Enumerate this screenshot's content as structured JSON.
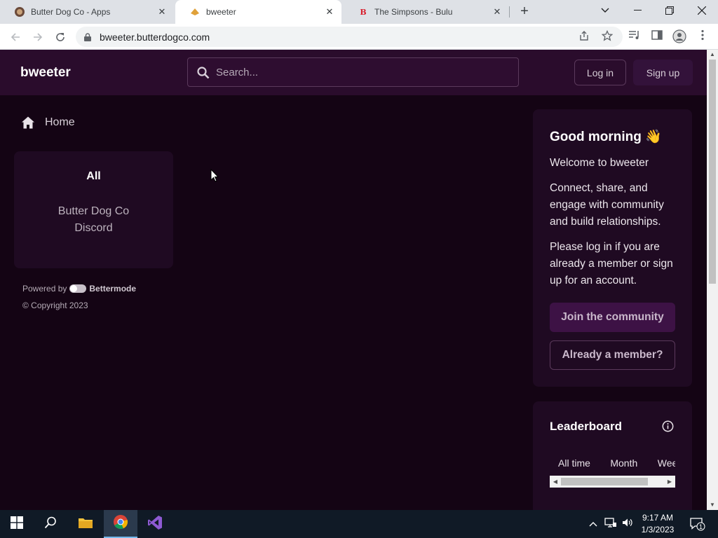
{
  "browser": {
    "tabs": [
      {
        "title": "Butter Dog Co - Apps",
        "close": "✕"
      },
      {
        "title": "bweeter",
        "close": "✕"
      },
      {
        "title": "The Simpsons - Bulu",
        "close": "✕"
      }
    ],
    "new_tab": "+",
    "url": "bweeter.butterdogco.com"
  },
  "header": {
    "brand": "bweeter",
    "search_placeholder": "Search...",
    "login_label": "Log in",
    "signup_label": "Sign up"
  },
  "sidebar": {
    "home_label": "Home",
    "spaces_all": "All",
    "spaces_item": "Butter Dog Co Discord",
    "powered_by": "Powered by",
    "powered_brand": "Bettermode",
    "copyright": "© Copyright 2023"
  },
  "welcome": {
    "title": "Good morning 👋",
    "line1": "Welcome to bweeter",
    "line2": "Connect, share, and engage with community and build relationships.",
    "line3": "Please log in if you are already a member or sign up for an account.",
    "join_label": "Join the community",
    "member_label": "Already a member?"
  },
  "leaderboard": {
    "title": "Leaderboard",
    "tabs": [
      "All time",
      "Month",
      "Week"
    ]
  },
  "taskbar": {
    "time": "9:17 AM",
    "date": "1/3/2023",
    "notif_count": "1"
  }
}
